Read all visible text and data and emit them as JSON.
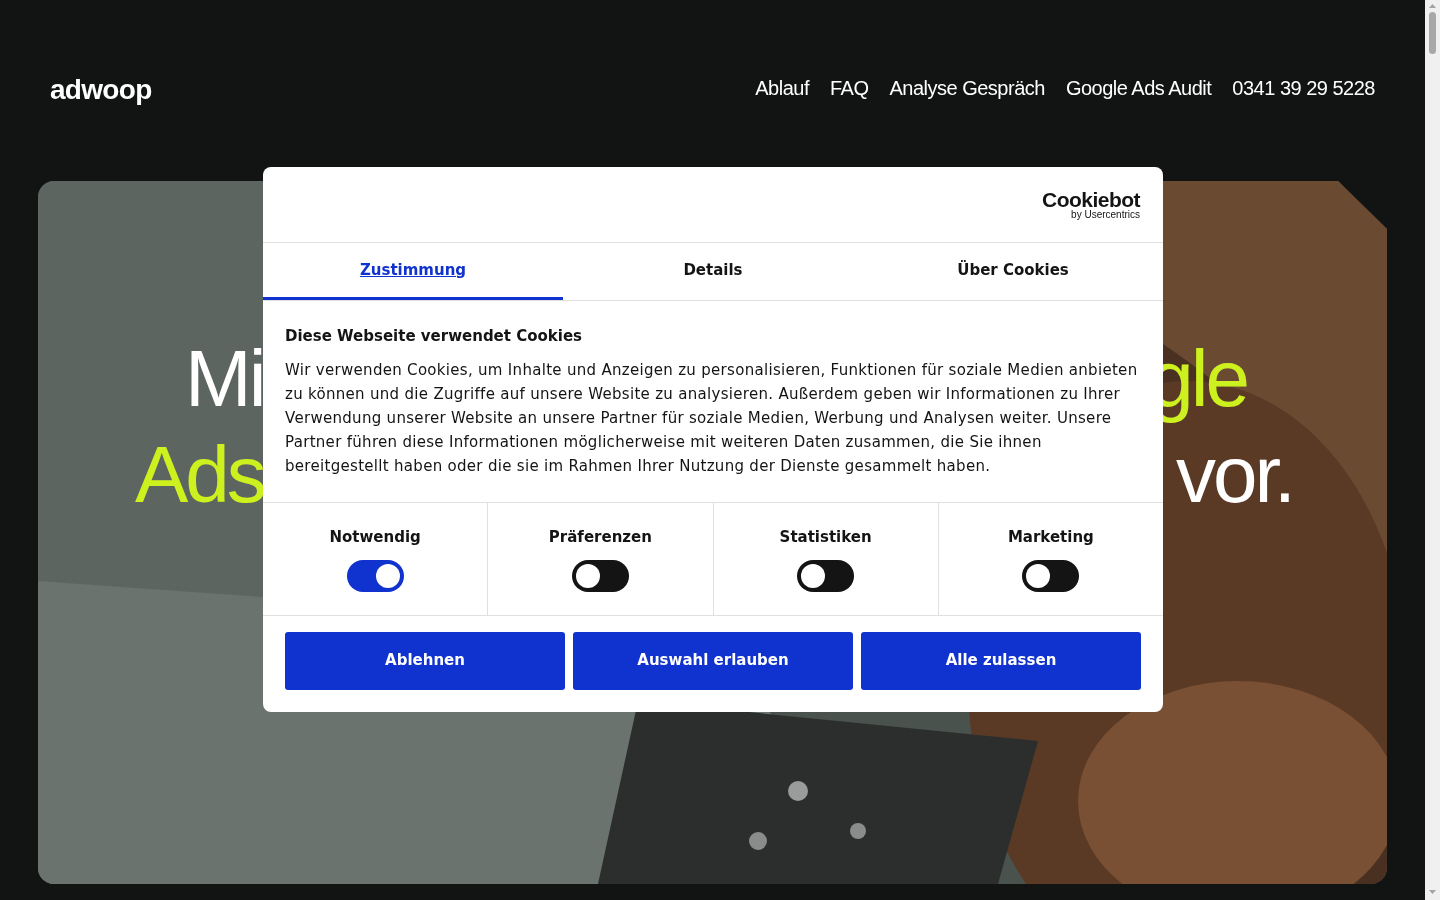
{
  "header": {
    "logo": "adwoop",
    "nav": [
      {
        "label": "Ablauf"
      },
      {
        "label": "FAQ"
      },
      {
        "label": "Analyse Gespräch"
      },
      {
        "label": "Google Ads Audit"
      },
      {
        "label": "0341 39 29 5228"
      }
    ]
  },
  "hero": {
    "kind": "picture",
    "lines": [
      [
        {
          "text": "Mi",
          "accent": false
        },
        {
          "text": "gle",
          "accent": true
        }
      ],
      [
        {
          "text": "Ads",
          "accent": true
        },
        {
          "text": "vor.",
          "accent": false
        }
      ]
    ]
  },
  "cookie_dialog": {
    "brand": "Cookiebot",
    "brand_sub": "by Usercentrics",
    "tabs": [
      {
        "label": "Zustimmung",
        "selected": true
      },
      {
        "label": "Details",
        "selected": false
      },
      {
        "label": "Über Cookies",
        "selected": false
      }
    ],
    "title": "Diese Webseite verwendet Cookies",
    "text": "Wir verwenden Cookies, um Inhalte und Anzeigen zu personalisieren, Funktionen für soziale Medien anbieten zu können und die Zugriffe auf unsere Website zu analysieren. Außerdem geben wir Informationen zu Ihrer Verwendung unserer Website an unsere Partner für soziale Medien, Werbung und Analysen weiter. Unsere Partner führen diese Informationen möglicherweise mit weiteren Daten zusammen, die Sie ihnen bereitgestellt haben oder die sie im Rahmen Ihrer Nutzung der Dienste gesammelt haben.",
    "categories": [
      {
        "label": "Notwendig",
        "on": true
      },
      {
        "label": "Präferenzen",
        "on": false
      },
      {
        "label": "Statistiken",
        "on": false
      },
      {
        "label": "Marketing",
        "on": false
      }
    ],
    "buttons": [
      "Ablehnen",
      "Auswahl erlauben",
      "Alle zulassen"
    ]
  }
}
